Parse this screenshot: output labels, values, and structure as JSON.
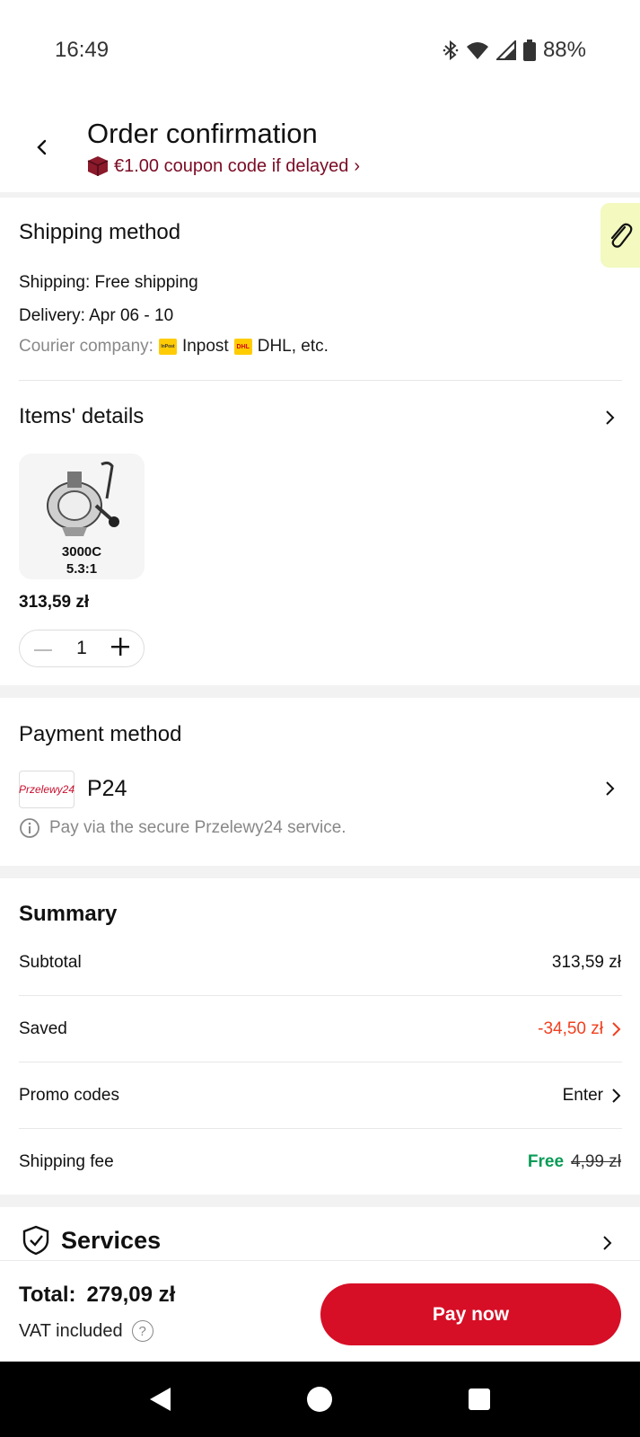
{
  "status_bar": {
    "time": "16:49",
    "battery": "88%",
    "icons": [
      "bluetooth-icon",
      "wifi-icon",
      "signal-icon",
      "battery-icon"
    ]
  },
  "header": {
    "title": "Order confirmation",
    "coupon_text": "€1.00 coupon code if delayed",
    "coupon_chevron": "›"
  },
  "shipping": {
    "title": "Shipping method",
    "shipping_line": "Shipping: Free shipping",
    "delivery_line": "Delivery: Apr 06 - 10",
    "courier_label": "Courier company:",
    "courier_1": "Inpost",
    "courier_2": "DHL, etc.",
    "logo_1_text": "InPost",
    "logo_2_text": "DHL"
  },
  "items": {
    "title": "Items' details",
    "product_model_line1": "3000C",
    "product_model_line2": "5.3:1",
    "price": "313,59 zł",
    "quantity": "1"
  },
  "payment": {
    "title": "Payment method",
    "logo_text": "Przelewy24",
    "method_name": "P24",
    "note": "Pay via the secure Przelewy24 service."
  },
  "summary": {
    "title": "Summary",
    "subtotal_label": "Subtotal",
    "subtotal_value": "313,59 zł",
    "saved_label": "Saved",
    "saved_value": "-34,50 zł",
    "promo_label": "Promo codes",
    "promo_value": "Enter",
    "shipping_label": "Shipping fee",
    "shipping_free": "Free",
    "shipping_original": "4,99 zł"
  },
  "services": {
    "title": "Services"
  },
  "footer": {
    "total_label": "Total:",
    "total_value": "279,09 zł",
    "vat_label": "VAT included",
    "pay_button": "Pay now"
  },
  "colors": {
    "brand_red": "#d60f26",
    "coupon_maroon": "#7a0b24",
    "saved_orange": "#f0401f",
    "free_green": "#0a9b57"
  }
}
